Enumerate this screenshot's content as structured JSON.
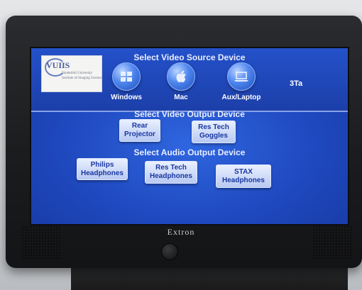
{
  "screen": {
    "source_title": "Select Video Source Device",
    "room_label": "3Ta",
    "sources": [
      {
        "label": "Windows",
        "icon": "windows-icon"
      },
      {
        "label": "Mac",
        "icon": "mac-icon"
      },
      {
        "label": "Aux/Laptop",
        "icon": "laptop-icon"
      }
    ],
    "video_output_title": "Select Video Output Device",
    "video_outputs": [
      {
        "line1": "Rear",
        "line2": "Projector"
      },
      {
        "line1": "Res Tech",
        "line2": "Goggles"
      }
    ],
    "audio_output_title": "Select Audio Output Device",
    "audio_outputs": [
      {
        "line1": "Philips",
        "line2": "Headphones"
      },
      {
        "line1": "Res Tech",
        "line2": "Headphones"
      },
      {
        "line1": "STAX",
        "line2": "Headphones"
      }
    ],
    "logo": {
      "mark": "VUIIS",
      "line1": "Vanderbilt University",
      "line2": "Institute of Imaging Science"
    }
  },
  "device": {
    "brand": "Extron"
  },
  "colors": {
    "screen_blue": "#1f49bf",
    "button_face": "#d6e1fb",
    "button_text": "#1a37a0"
  }
}
